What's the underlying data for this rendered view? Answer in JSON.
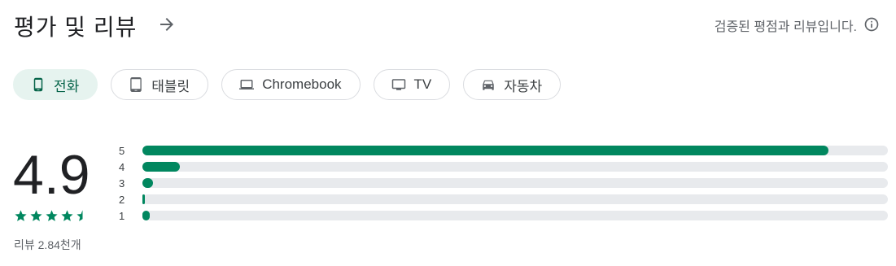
{
  "header": {
    "title": "평가 및 리뷰",
    "verified_text": "검증된 평점과 리뷰입니다."
  },
  "device_chips": [
    {
      "label": "전화",
      "icon": "phone-icon",
      "selected": true
    },
    {
      "label": "태블릿",
      "icon": "tablet-icon",
      "selected": false
    },
    {
      "label": "Chromebook",
      "icon": "laptop-icon",
      "selected": false
    },
    {
      "label": "TV",
      "icon": "tv-icon",
      "selected": false
    },
    {
      "label": "자동차",
      "icon": "car-icon",
      "selected": false
    }
  ],
  "rating": {
    "score": "4.9",
    "stars": 4.5,
    "review_count": "리뷰 2.84천개"
  },
  "distribution": [
    {
      "label": "5",
      "fraction": 0.92
    },
    {
      "label": "4",
      "fraction": 0.05
    },
    {
      "label": "3",
      "fraction": 0.014
    },
    {
      "label": "2",
      "fraction": 0.003
    },
    {
      "label": "1",
      "fraction": 0.01
    }
  ],
  "colors": {
    "accent": "#01875f",
    "chip_selected_bg": "#e6f3ef",
    "track": "#e8eaed"
  }
}
